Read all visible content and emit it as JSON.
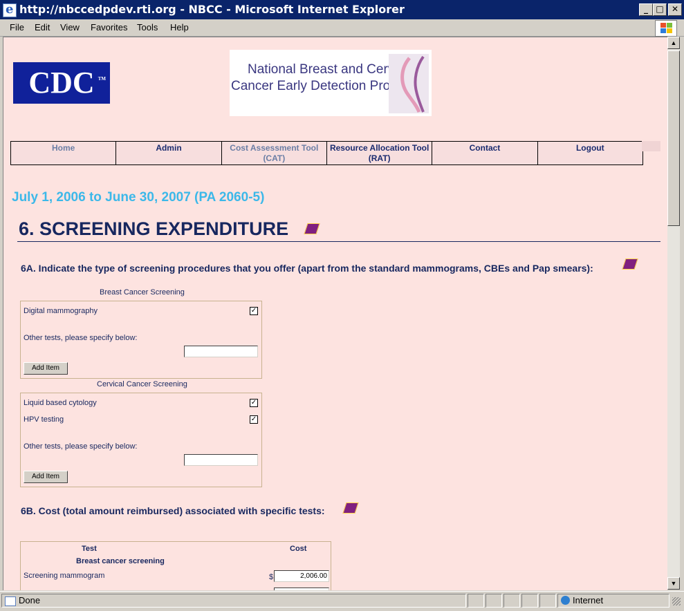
{
  "window": {
    "title": "http://nbccedpdev.rti.org - NBCC - Microsoft Internet Explorer",
    "minimize": "_",
    "maximize": "□",
    "close": "✕"
  },
  "menu": [
    "File",
    "Edit",
    "View",
    "Favorites",
    "Tools",
    "Help"
  ],
  "header": {
    "cdc_logo": "CDC",
    "program_line1": "National Breast and Cervical",
    "program_line2": "Cancer Early Detection Program"
  },
  "nav": [
    {
      "label": "Home",
      "style": "gray"
    },
    {
      "label": "Admin",
      "style": "normal"
    },
    {
      "label": "Cost Assessment Tool (CAT)",
      "style": "gray"
    },
    {
      "label": "Resource Allocation Tool (RAT)",
      "style": "normal"
    },
    {
      "label": "Contact",
      "style": "normal"
    },
    {
      "label": "Logout",
      "style": "normal"
    }
  ],
  "period": "July 1, 2006 to June 30, 2007 (PA 2060-5)",
  "section": {
    "title": "6. SCREENING EXPENDITURE",
    "q6a": "6A. Indicate the type of screening procedures that you offer (apart from the standard mammograms, CBEs and Pap smears):",
    "q6b": "6B. Cost (total amount reimbursed) associated with specific tests:"
  },
  "breast": {
    "caption": "Breast Cancer Screening",
    "items": [
      {
        "label": "Digital mammography",
        "checked": true
      }
    ],
    "other_label": "Other tests, please specify below:",
    "other_value": "",
    "add_button": "Add Item"
  },
  "cervical": {
    "caption": "Cervical Cancer Screening",
    "items": [
      {
        "label": "Liquid based cytology",
        "checked": true
      },
      {
        "label": "HPV testing",
        "checked": true
      }
    ],
    "other_label": "Other tests, please specify below:",
    "other_value": "",
    "add_button": "Add Item"
  },
  "cost_table": {
    "col_test": "Test",
    "col_cost": "Cost",
    "group": "Breast cancer screening",
    "rows": [
      {
        "label": "Screening mammogram",
        "currency": "$",
        "value": "2,006.00"
      }
    ]
  },
  "status": {
    "text": "Done",
    "zone": "Internet"
  }
}
